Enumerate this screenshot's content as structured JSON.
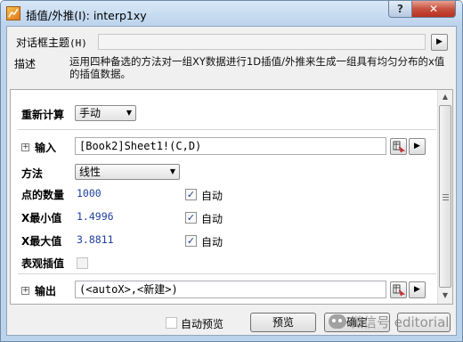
{
  "window": {
    "title": "插值/外推(I): interp1xy",
    "help_glyph": "?",
    "close_glyph": "✕"
  },
  "header": {
    "theme_label": "对话框主题",
    "theme_shortcut": "(H)",
    "theme_value": "",
    "description_label": "描述",
    "description_text": "运用四种备选的方法对一组XY数据进行1D插值/外推来生成一组具有均匀分布的x值的插值数据。"
  },
  "form": {
    "recalc_label": "重新计算",
    "recalc_value": "手动",
    "input_label": "输入",
    "input_value": "[Book2]Sheet1!(C,D)",
    "method_label": "方法",
    "method_value": "线性",
    "points_label": "点的数量",
    "points_value": "1000",
    "points_auto": "自动",
    "xmin_label": "X最小值",
    "xmin_value": "1.4996",
    "xmin_auto": "自动",
    "xmax_label": "X最大值",
    "xmax_value": "3.8811",
    "xmax_auto": "自动",
    "apparent_label": "表观插值",
    "output_label": "输出",
    "output_value": "(<autoX>,<新建>)"
  },
  "footer": {
    "auto_preview_label": "自动预览",
    "preview_button": "预览",
    "ok_button": "确定"
  },
  "watermark": {
    "text": "微信号 editorial"
  },
  "colors": {
    "titlebar": "#bcd3ec",
    "value_blue": "#1f3f9f",
    "close_red": "#c75140"
  }
}
